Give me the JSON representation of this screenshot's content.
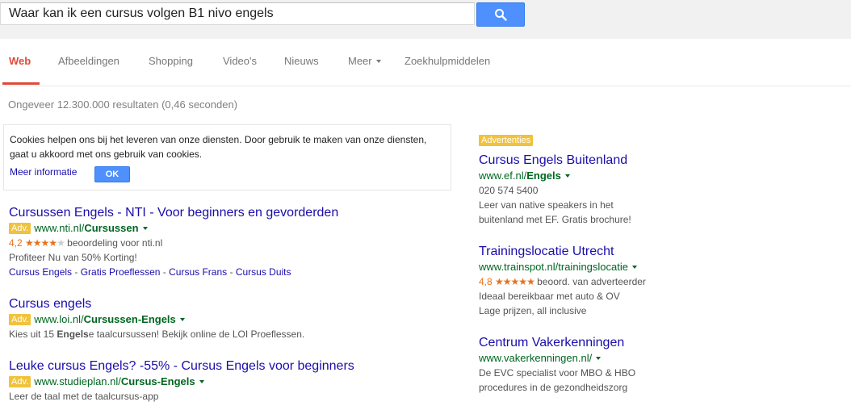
{
  "search": {
    "query": "Waar kan ik een cursus volgen B1 nivo engels",
    "button_icon": "search-icon"
  },
  "tabs": [
    {
      "label": "Web",
      "active": true
    },
    {
      "label": "Afbeeldingen"
    },
    {
      "label": "Shopping"
    },
    {
      "label": "Video's"
    },
    {
      "label": "Nieuws"
    },
    {
      "label": "Meer"
    },
    {
      "label": "Zoekhulpmiddelen"
    }
  ],
  "stats": "Ongeveer 12.300.000 resultaten (0,46 seconden)",
  "cookie": {
    "text": "Cookies helpen ons bij het leveren van onze diensten. Door gebruik te maken van onze diensten, gaat u akkoord met ons gebruik van cookies.",
    "more_info": "Meer informatie",
    "ok": "OK"
  },
  "results": [
    {
      "title": "Cursussen Engels - NTI - Voor beginners en gevorderden",
      "badge": "Adv.",
      "url_prefix": "www.nti.nl/",
      "url_bold": "Cursussen",
      "rating_value": "4,2",
      "rating_stars": 4,
      "rating_text": "beoordeling voor nti.nl",
      "line1": "Profiteer Nu van 50% Korting!",
      "sitelinks": [
        "Cursus Engels",
        "Gratis Proeflessen",
        "Cursus Frans",
        "Cursus Duits"
      ]
    },
    {
      "title": "Cursus engels",
      "badge": "Adv.",
      "url_prefix": "www.loi.nl/",
      "url_bold": "Cursussen-Engels",
      "desc_pre": "Kies uit 15 ",
      "desc_bold": "Engels",
      "desc_post": "e taalcursussen! Bekijk online de LOI Proeflessen."
    },
    {
      "title": "Leuke cursus Engels? -55% - Cursus Engels voor beginners",
      "badge": "Adv.",
      "url_prefix": "www.studieplan.nl/",
      "url_bold": "Cursus-Engels",
      "line1": "Leer de taal met de taalcursus-app"
    }
  ],
  "ads": {
    "label": "Advertenties",
    "items": [
      {
        "title": "Cursus Engels Buitenland",
        "url_prefix": "www.ef.nl/",
        "url_bold": "Engels",
        "phone": "020 574 5400",
        "line1": "Leer van native speakers in het",
        "line2": "buitenland met EF. Gratis brochure!"
      },
      {
        "title": "Trainingslocatie Utrecht",
        "url_prefix": "www.trainspot.nl/trainingslocatie",
        "url_bold": "",
        "rating_value": "4,8",
        "rating_stars": 5,
        "rating_text": "beoord. van adverteerder",
        "line1": "Ideaal bereikbaar met auto & OV",
        "line2": "Lage prijzen, all inclusive"
      },
      {
        "title": "Centrum Vakerkenningen",
        "url_prefix": "www.vakerkenningen.nl/",
        "url_bold": "",
        "line1": "De EVC specialist voor MBO & HBO",
        "line2": "procedures in de gezondheidszorg"
      }
    ]
  },
  "colors": {
    "link": "#1a0dab",
    "url": "#006621",
    "accent": "#dd4b39",
    "ad_badge": "#f0c23d",
    "button": "#4d90fe",
    "star": "#e7711b"
  }
}
